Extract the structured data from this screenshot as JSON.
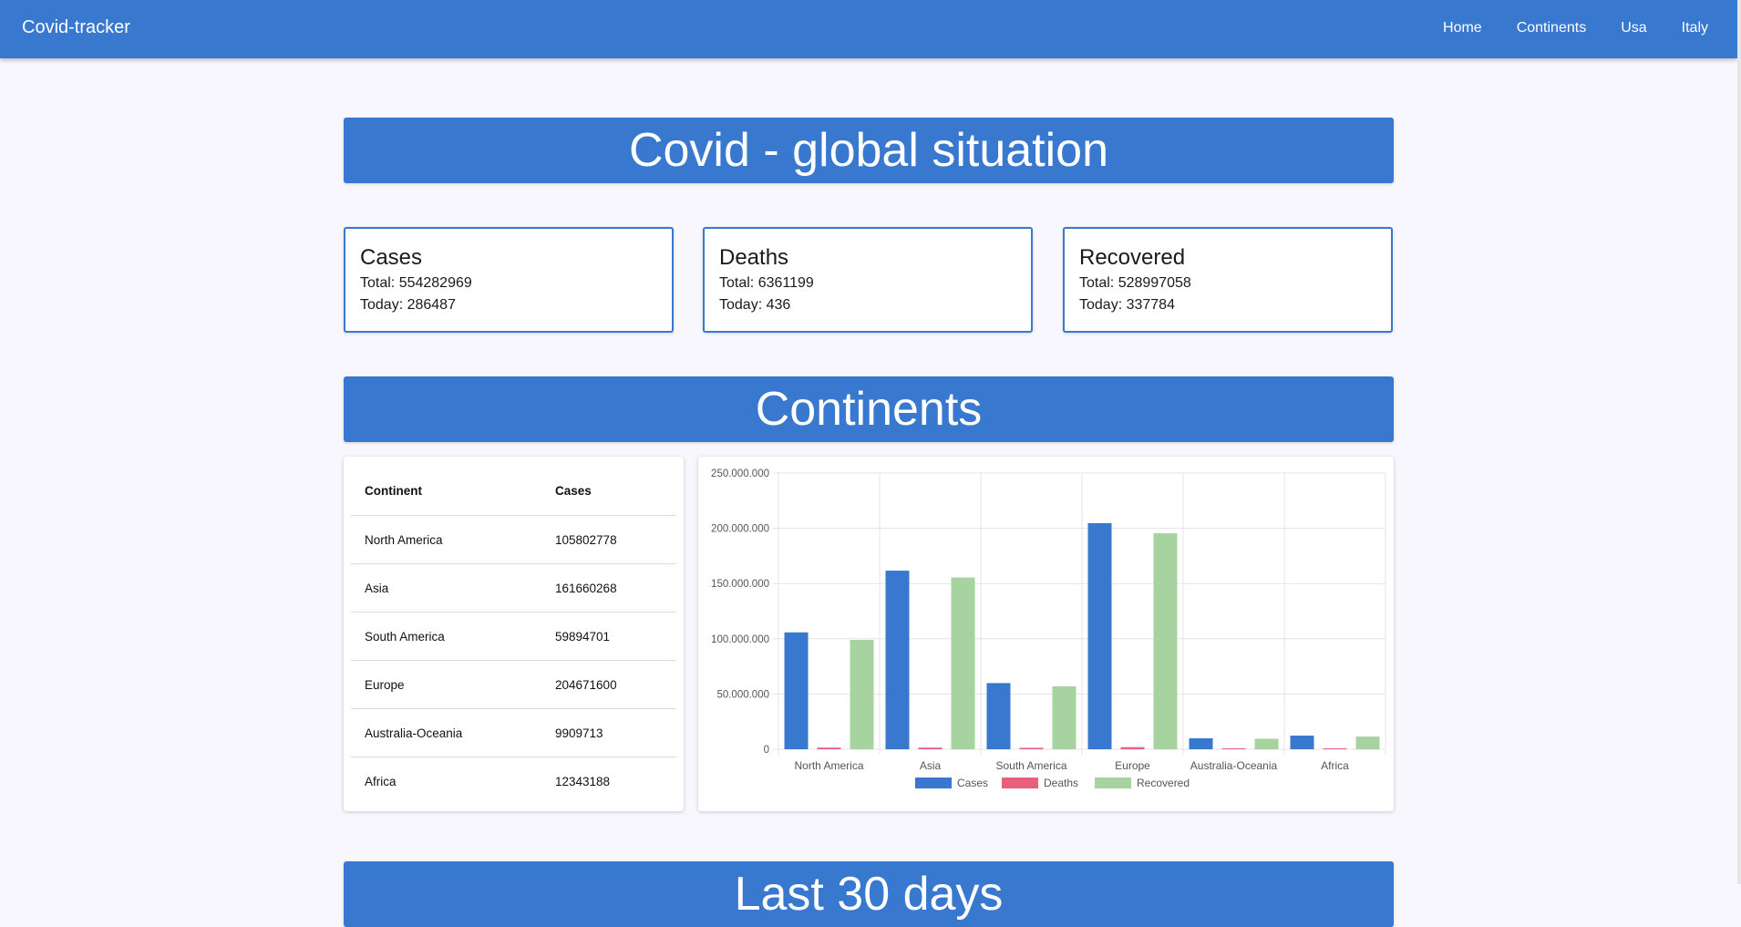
{
  "nav": {
    "brand": "Covid-tracker",
    "links": [
      "Home",
      "Continents",
      "Usa",
      "Italy"
    ]
  },
  "sections": {
    "global_title": "Covid - global situation",
    "continents_title": "Continents",
    "last_title": "Last 30 days"
  },
  "stats": [
    {
      "title": "Cases",
      "total": "Total: 554282969",
      "today": "Today: 286487"
    },
    {
      "title": "Deaths",
      "total": "Total: 6361199",
      "today": "Today: 436"
    },
    {
      "title": "Recovered",
      "total": "Total: 528997058",
      "today": "Today: 337784"
    }
  ],
  "table": {
    "headers": [
      "Continent",
      "Cases"
    ],
    "rows": [
      [
        "North America",
        "105802778"
      ],
      [
        "Asia",
        "161660268"
      ],
      [
        "South America",
        "59894701"
      ],
      [
        "Europe",
        "204671600"
      ],
      [
        "Australia-Oceania",
        "9909713"
      ],
      [
        "Africa",
        "12343188"
      ]
    ]
  },
  "colors": {
    "primary": "#3878cf",
    "cases": "#3878cf",
    "deaths": "#e8607d",
    "recovered": "#a6d3a0"
  },
  "chart_data": {
    "type": "bar",
    "categories": [
      "North America",
      "Asia",
      "South America",
      "Europe",
      "Australia-Oceania",
      "Africa"
    ],
    "series": [
      {
        "name": "Cases",
        "color": "#3878cf",
        "values": [
          105802778,
          161660268,
          59894701,
          204671600,
          9909713,
          12343188
        ]
      },
      {
        "name": "Deaths",
        "color": "#e8607d",
        "values": [
          1500000,
          1500000,
          1300000,
          1900000,
          20000,
          250000
        ]
      },
      {
        "name": "Recovered",
        "color": "#a6d3a0",
        "values": [
          99000000,
          155500000,
          57000000,
          195500000,
          9500000,
          11500000
        ]
      }
    ],
    "ylim": [
      0,
      250000000
    ],
    "yticks": [
      "250.000.000",
      "200.000.000",
      "150.000.000",
      "100.000.000",
      "50.000.000",
      "0"
    ],
    "ytick_values": [
      250000000,
      200000000,
      150000000,
      100000000,
      50000000,
      0
    ],
    "grid": true,
    "legend_position": "bottom"
  }
}
